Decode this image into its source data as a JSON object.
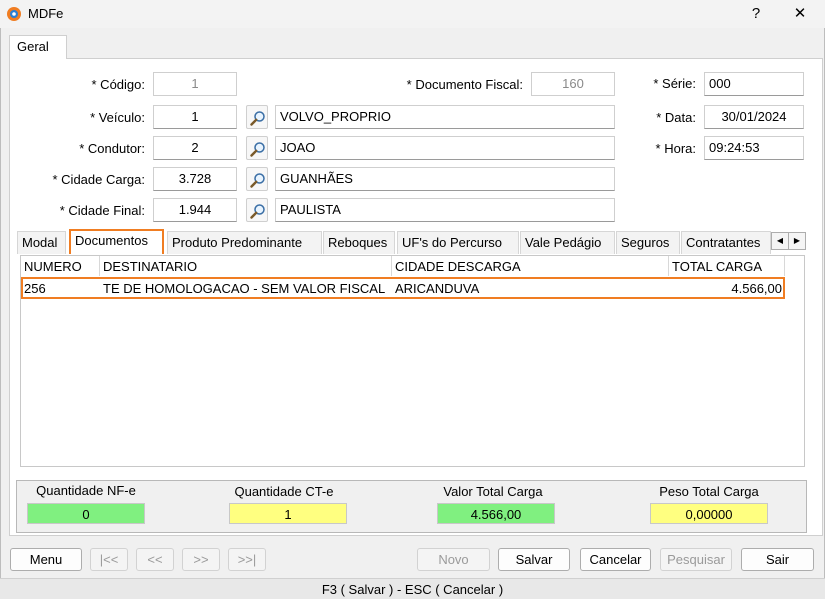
{
  "window": {
    "title": "MDFe",
    "help_label": "?",
    "close_label": "✕"
  },
  "tabs": {
    "geral": "Geral"
  },
  "form": {
    "codigo": {
      "label": "* Código:",
      "value": "1"
    },
    "documento_fiscal": {
      "label": "* Documento Fiscal:",
      "value": "160"
    },
    "serie": {
      "label": "* Série:",
      "value": "000"
    },
    "veiculo": {
      "label": "* Veículo:",
      "code": "1",
      "name": "VOLVO_PROPRIO"
    },
    "data": {
      "label": "* Data:",
      "value": "30/01/2024"
    },
    "condutor": {
      "label": "* Condutor:",
      "code": "2",
      "name": "JOAO"
    },
    "hora": {
      "label": "* Hora:",
      "value": "09:24:53"
    },
    "cidade_carga": {
      "label": "* Cidade Carga:",
      "code": "3.728",
      "name": "GUANHÃES"
    },
    "cidade_final": {
      "label": "* Cidade Final:",
      "code": "1.944",
      "name": "PAULISTA"
    }
  },
  "subtabs": [
    "Modal",
    "Documentos",
    "Produto Predominante",
    "Reboques",
    "UF's do Percurso",
    "Vale Pedágio",
    "Seguros",
    "Contratantes"
  ],
  "scroll_left": "◀",
  "scroll_right": "▶",
  "grid": {
    "columns": [
      "NUMERO",
      "DESTINATARIO",
      "CIDADE DESCARGA",
      "TOTAL CARGA"
    ],
    "rows": [
      {
        "numero": "256",
        "destinatario": "TE DE HOMOLOGACAO - SEM VALOR FISCAL",
        "cidade": "ARICANDUVA",
        "total": "4.566,00"
      }
    ]
  },
  "totals": {
    "nfe": {
      "label": "Quantidade NF-e",
      "value": "0",
      "color": "#80f080"
    },
    "cte": {
      "label": "Quantidade CT-e",
      "value": "1",
      "color": "#ffff80"
    },
    "valor": {
      "label": "Valor Total Carga",
      "value": "4.566,00",
      "color": "#80f080"
    },
    "peso": {
      "label": "Peso Total Carga",
      "value": "0,00000",
      "color": "#ffff80"
    }
  },
  "buttons": {
    "menu": "Menu",
    "first": "|<<",
    "prev": "<<",
    "next": ">>",
    "last": ">>|",
    "novo": "Novo",
    "salvar": "Salvar",
    "cancelar": "Cancelar",
    "pesquisar": "Pesquisar",
    "sair": "Sair"
  },
  "status": "F3 ( Salvar )  -  ESC ( Cancelar )",
  "colors": {
    "accent": "#f07d22"
  }
}
